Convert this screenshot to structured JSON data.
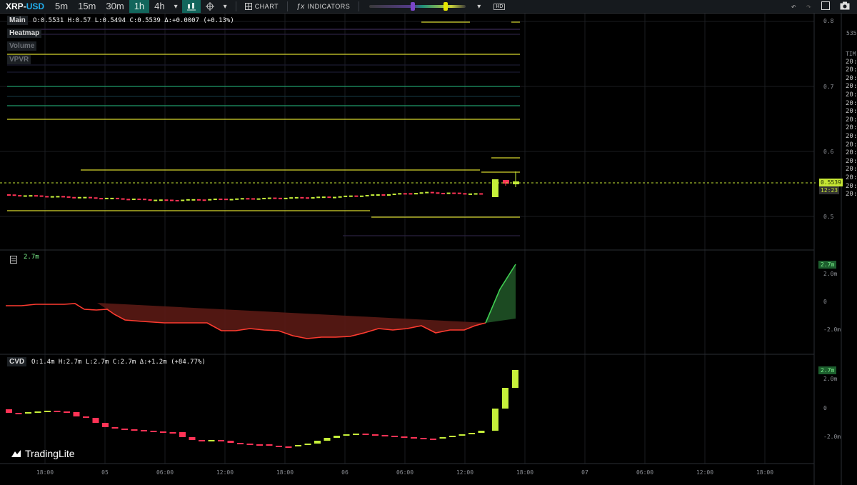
{
  "toolbar": {
    "symbol_base": "XRP",
    "symbol_sep": "-",
    "symbol_quote": "USD",
    "timeframes": [
      "5m",
      "15m",
      "30m",
      "1h",
      "4h"
    ],
    "active_timeframe": "1h",
    "chart_label": "CHART",
    "indicators_label": "INDICATORS",
    "hd_label": "HD"
  },
  "main_pane": {
    "tag": "Main",
    "ohlc": "O:0.5531 H:0.57 L:0.5494 C:0.5539 Δ:+0.0007 (+0.13%)",
    "layers": [
      "Heatmap",
      "Volume",
      "VPVR"
    ],
    "price_ticks": [
      "0.8",
      "0.7",
      "0.6",
      "0.5"
    ],
    "current_price": "0.5539",
    "countdown": "12:23"
  },
  "oi_pane": {
    "value_label": "2.7m",
    "badge": "2.7m",
    "ticks": [
      "2.0m",
      "0",
      "-2.0m"
    ]
  },
  "cvd_pane": {
    "tag": "CVD",
    "ohlc": "O:1.4m H:2.7m L:2.7m C:2.7m Δ:+1.2m (+84.77%)",
    "badge": "2.7m",
    "ticks": [
      "2.0m",
      "0",
      "-2.0m"
    ]
  },
  "time_axis": [
    "18:00",
    "05",
    "06:00",
    "12:00",
    "18:00",
    "06",
    "06:00",
    "12:00",
    "18:00",
    "07",
    "06:00",
    "12:00",
    "18:00"
  ],
  "right_panel": {
    "count": "535",
    "header": "TIM",
    "rows": [
      "20:",
      "20:",
      "20:",
      "20:",
      "20:",
      "20:",
      "20:",
      "20:",
      "20:",
      "20:",
      "20:",
      "20:",
      "20:",
      "20:",
      "20:",
      "20:",
      "20:"
    ]
  },
  "branding": {
    "logo_text": "TradingLite"
  },
  "colors": {
    "up": "#c6f03a",
    "down": "#ff3356",
    "accent": "#12665c",
    "level": "#d6d62c"
  }
}
